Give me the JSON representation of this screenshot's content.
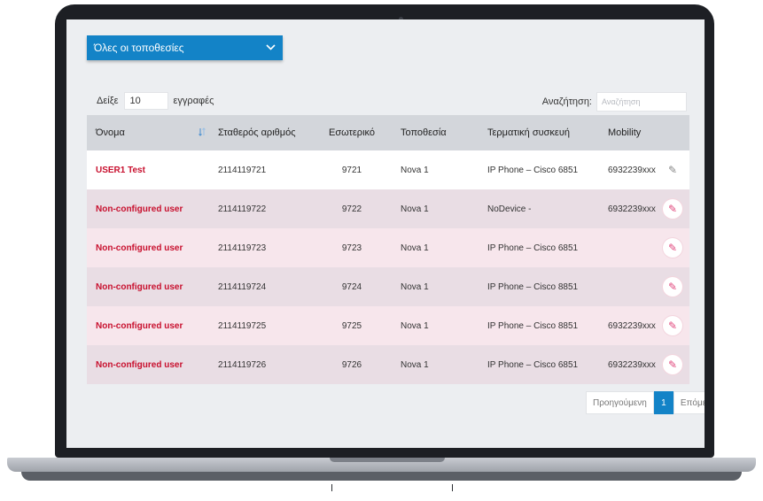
{
  "location_select": {
    "label": "Όλες οι τοποθεσίες",
    "chevron": "chevron-down-icon"
  },
  "length_control": {
    "prefix": "Δείξε",
    "value": "10",
    "suffix": "εγγραφές"
  },
  "search": {
    "label": "Αναζήτηση:",
    "placeholder": "Αναζήτηση"
  },
  "table": {
    "headers": {
      "name": "Όνομα",
      "fixed": "Σταθερός αριθμός",
      "ext": "Εσωτερικό",
      "loc": "Τοποθεσία",
      "dev": "Τερματική συσκευή",
      "mob": "Mobility"
    },
    "rows": [
      {
        "name": "USER1 Test",
        "fixed": "2114119721",
        "ext": "9721",
        "loc": "Nova 1",
        "dev": "IP Phone – Cisco 6851",
        "mob": "6932239xxx"
      },
      {
        "name": "Non-configured user",
        "fixed": "2114119722",
        "ext": "9722",
        "loc": "Nova 1",
        "dev": "NoDevice -",
        "mob": "6932239xxx"
      },
      {
        "name": "Non-configured user",
        "fixed": "2114119723",
        "ext": "9723",
        "loc": "Nova 1",
        "dev": "IP Phone – Cisco 6851",
        "mob": ""
      },
      {
        "name": "Non-configured user",
        "fixed": "2114119724",
        "ext": "9724",
        "loc": "Nova 1",
        "dev": "IP Phone – Cisco 8851",
        "mob": ""
      },
      {
        "name": "Non-configured user",
        "fixed": "2114119725",
        "ext": "9725",
        "loc": "Nova 1",
        "dev": "IP Phone – Cisco 8851",
        "mob": "6932239xxx"
      },
      {
        "name": "Non-configured user",
        "fixed": "2114119726",
        "ext": "9726",
        "loc": "Nova 1",
        "dev": "IP Phone – Cisco 6851",
        "mob": "6932239xxx"
      }
    ]
  },
  "pagination": {
    "prev": "Προηγούμενη",
    "current": "1",
    "next": "Επόμενη"
  },
  "colors": {
    "accent": "#1383c7",
    "name_red": "#c8102e",
    "row_mauve": "#e9dde4",
    "row_pink": "#f7e6ec",
    "header_gray": "#d3d6db"
  }
}
